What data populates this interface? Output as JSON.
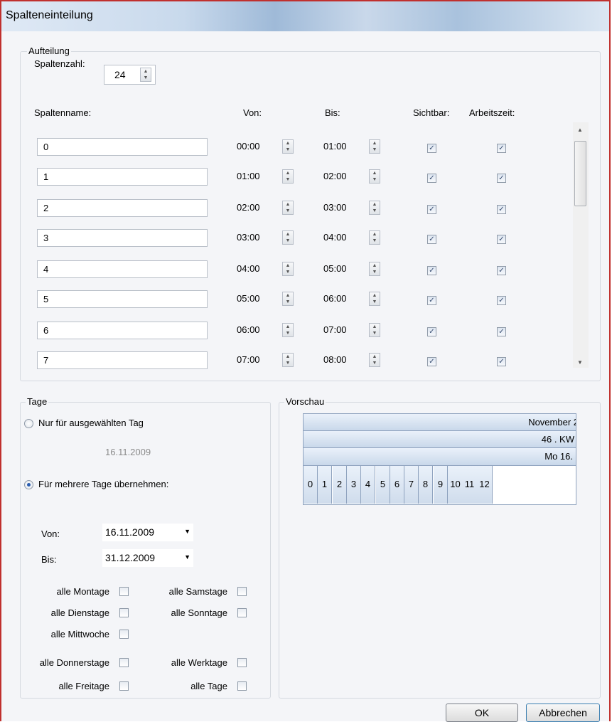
{
  "window": {
    "title": "Spalteneinteilung"
  },
  "aufteilung": {
    "label": "Aufteilung",
    "spaltenzahl_label": "Spaltenzahl:",
    "spaltenzahl_value": "24",
    "headers": {
      "name": "Spaltenname:",
      "von": "Von:",
      "bis": "Bis:",
      "sichtbar": "Sichtbar:",
      "arbeitszeit": "Arbeitszeit:"
    },
    "rows": [
      {
        "name": "0",
        "von": "00:00",
        "bis": "01:00",
        "sichtbar": true,
        "arbeitszeit": true
      },
      {
        "name": "1",
        "von": "01:00",
        "bis": "02:00",
        "sichtbar": true,
        "arbeitszeit": true
      },
      {
        "name": "2",
        "von": "02:00",
        "bis": "03:00",
        "sichtbar": true,
        "arbeitszeit": true
      },
      {
        "name": "3",
        "von": "03:00",
        "bis": "04:00",
        "sichtbar": true,
        "arbeitszeit": true
      },
      {
        "name": "4",
        "von": "04:00",
        "bis": "05:00",
        "sichtbar": true,
        "arbeitszeit": true
      },
      {
        "name": "5",
        "von": "05:00",
        "bis": "06:00",
        "sichtbar": true,
        "arbeitszeit": true
      },
      {
        "name": "6",
        "von": "06:00",
        "bis": "07:00",
        "sichtbar": true,
        "arbeitszeit": true
      },
      {
        "name": "7",
        "von": "07:00",
        "bis": "08:00",
        "sichtbar": true,
        "arbeitszeit": true
      }
    ]
  },
  "tage": {
    "label": "Tage",
    "option_single": "Nur für ausgewählten Tag",
    "single_date": "16.11.2009",
    "option_multi": "Für mehrere Tage übernehmen:",
    "selected": "multi",
    "von_label": "Von:",
    "von_value": "16.11.2009",
    "bis_label": "Bis:",
    "bis_value": "31.12.2009",
    "weekday_options": {
      "montage": "alle Montage",
      "dienstage": "alle Dienstage",
      "mittwoche": "alle Mittwoche",
      "donnerstage": "alle Donnerstage",
      "freitage": "alle Freitage",
      "samstage": "alle Samstage",
      "sonntage": "alle Sonntage",
      "werktage": "alle Werktage",
      "tage": "alle Tage"
    }
  },
  "vorschau": {
    "label": "Vorschau",
    "month": "November 2",
    "week": "46 . KW",
    "day": "Mo 16.",
    "hours": [
      "0",
      "1",
      "2",
      "3",
      "4",
      "5",
      "6",
      "7",
      "8",
      "9",
      "10",
      "11",
      "12"
    ]
  },
  "buttons": {
    "ok": "OK",
    "cancel": "Abbrechen"
  }
}
